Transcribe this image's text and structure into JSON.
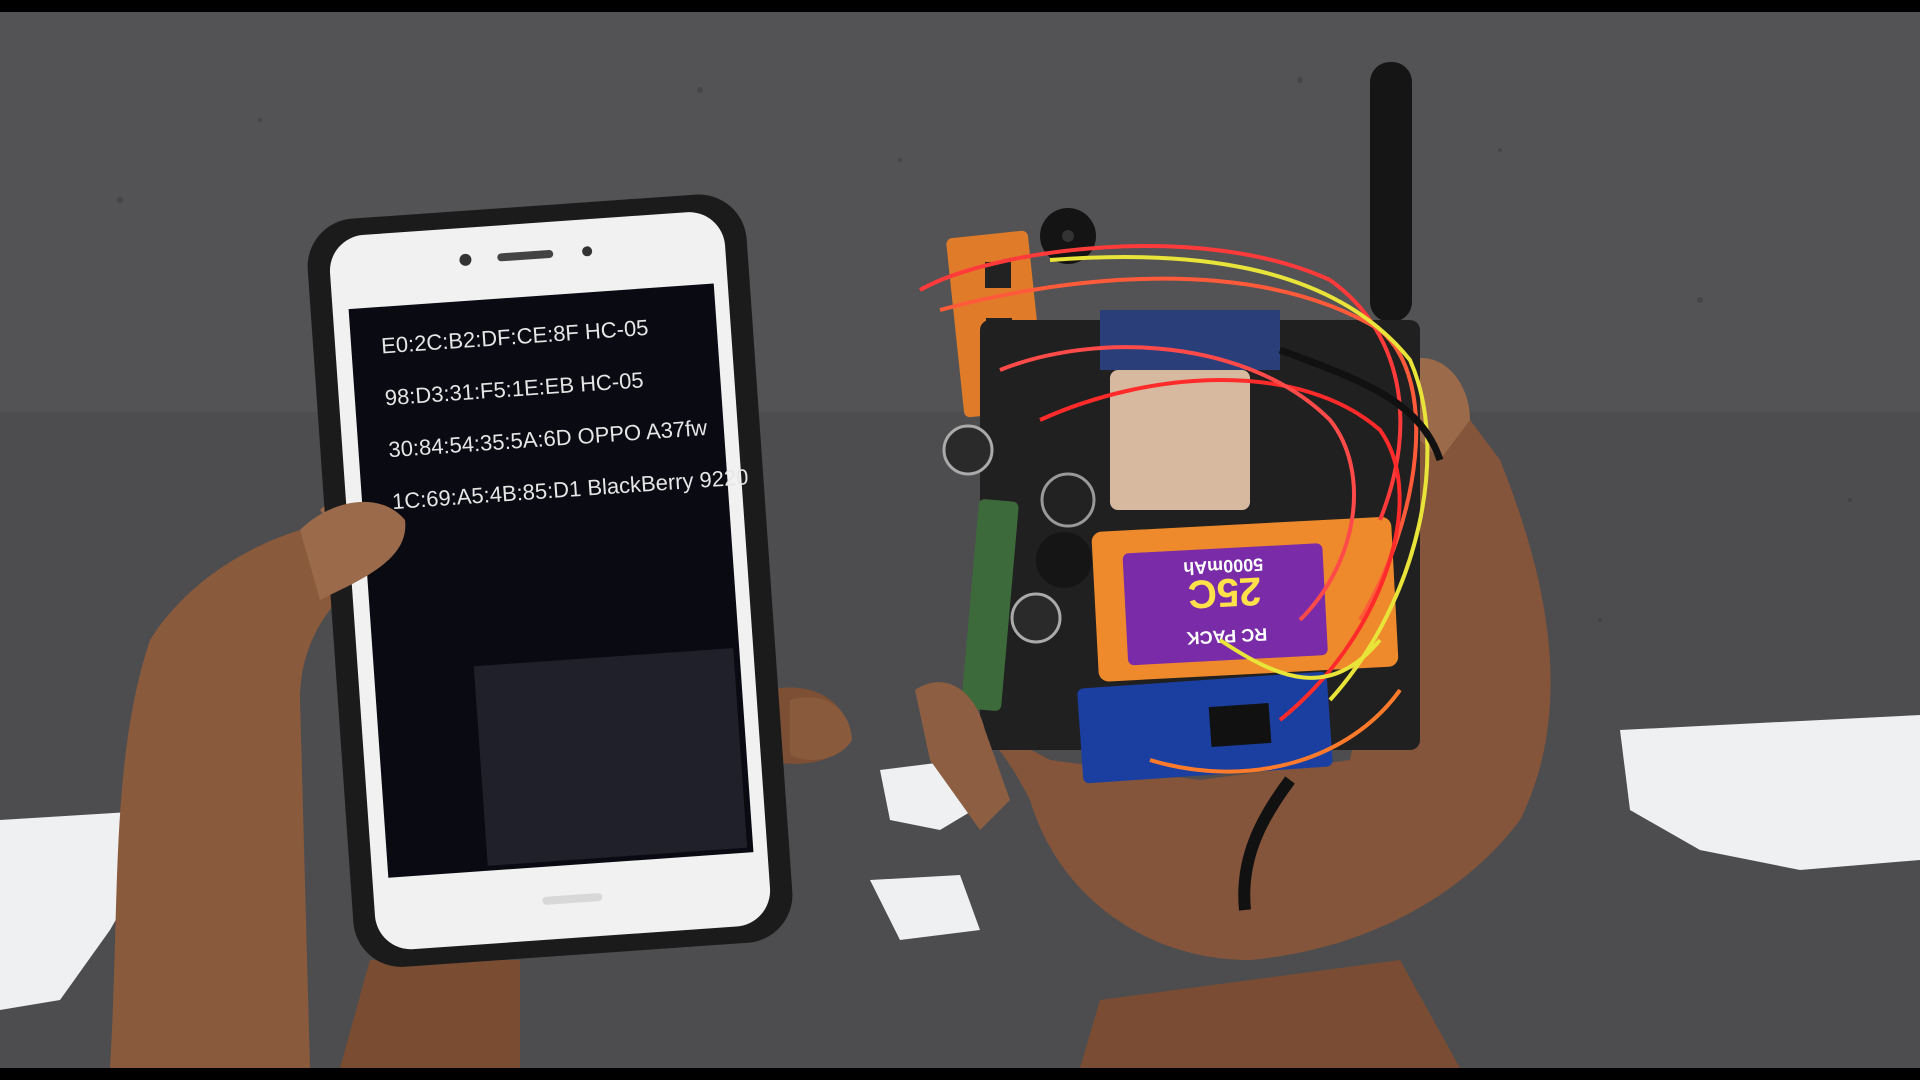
{
  "phone": {
    "status_bar": "",
    "app_title": "",
    "devices": [
      {
        "label": "E0:2C:B2:DF:CE:8F HC-05"
      },
      {
        "label": "98:D3:31:F5:1E:EB HC-05"
      },
      {
        "label": "30:84:54:35:5A:6D OPPO A37fw"
      },
      {
        "label": "1C:69:A5:4B:85:D1 BlackBerry 9220"
      }
    ]
  },
  "battery": {
    "capacity": "5000mAh",
    "rating": "25C",
    "brand": "RC PACK"
  },
  "colors": {
    "road": "#4d4d4f",
    "road_marking": "#eef0f1",
    "phone_body": "#1b1b1c",
    "phone_bezel": "#f1f1f1",
    "phone_screen": "#0a0a12",
    "skin": "#8a5a3c",
    "pcb_orange": "#e07b2a",
    "battery_orange": "#ee8a2c",
    "battery_label": "#7a2ba8",
    "arduino_blue": "#1b3fa0",
    "wire_red": "#ff3a3a",
    "wire_yellow": "#e8e43a"
  }
}
